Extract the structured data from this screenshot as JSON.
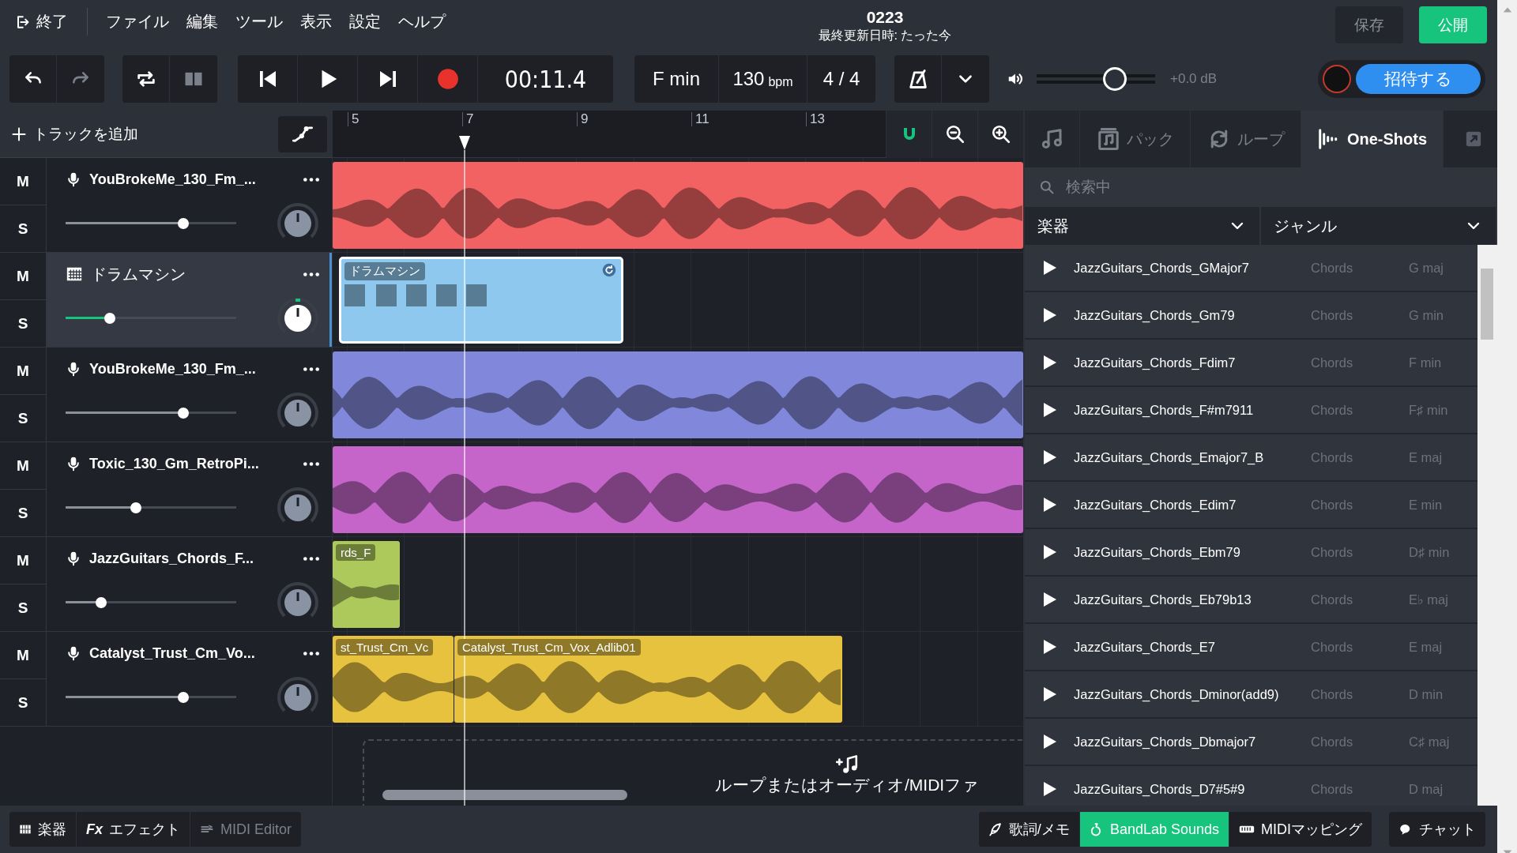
{
  "menu": {
    "exit": "終了",
    "items": [
      "ファイル",
      "編集",
      "ツール",
      "表示",
      "設定",
      "ヘルプ"
    ]
  },
  "project": {
    "title": "0223",
    "subtitle": "最終更新日時: たった今"
  },
  "actions": {
    "save": "保存",
    "publish": "公開",
    "invite": "招待する"
  },
  "toolbar": {
    "undo": {
      "disabled": false
    },
    "redo": {
      "disabled": true
    },
    "loop": {
      "disabled": false
    },
    "split": {
      "disabled": true
    },
    "time": "00:11.4",
    "key": "F min",
    "tempo": "130",
    "tempo_unit": "bpm",
    "signature": "4 / 4"
  },
  "master": {
    "level": 0.66,
    "reading": "+0.0 dB"
  },
  "add_track": "トラックを追加",
  "tracks": [
    {
      "kind": "audio",
      "name": "YouBrokeMe_130_Fm_...",
      "mute": "M",
      "solo": "S",
      "selected": false,
      "level": 0.69,
      "color": "#f26262"
    },
    {
      "kind": "drum",
      "name": "ドラムマシン",
      "mute": "M",
      "solo": "S",
      "selected": true,
      "level": 0.26,
      "color": "#8ec8ee",
      "clips": [
        {
          "label": "ドラムマシン"
        }
      ]
    },
    {
      "kind": "audio",
      "name": "YouBrokeMe_130_Fm_...",
      "mute": "M",
      "solo": "S",
      "selected": false,
      "level": 0.69,
      "color": "#8187da"
    },
    {
      "kind": "audio",
      "name": "Toxic_130_Gm_RetroPi...",
      "mute": "M",
      "solo": "S",
      "selected": false,
      "level": 0.41,
      "color": "#c565c9"
    },
    {
      "kind": "audio",
      "name": "JazzGuitars_Chords_F...",
      "mute": "M",
      "solo": "S",
      "selected": false,
      "level": 0.21,
      "color": "#adc95c",
      "clips": [
        {
          "label": "rds_F"
        }
      ]
    },
    {
      "kind": "audio",
      "name": "Catalyst_Trust_Cm_Vo...",
      "mute": "M",
      "solo": "S",
      "selected": false,
      "level": 0.69,
      "color": "#e7c23f",
      "clips": [
        {
          "label": "st_Trust_Cm_Vc"
        },
        {
          "label": "Catalyst_Trust_Cm_Vox_Adlib01"
        }
      ]
    }
  ],
  "ruler": [
    "5",
    "7",
    "9",
    "11",
    "13"
  ],
  "drop_hint": "ループまたはオーディオ/MIDIファ",
  "browser": {
    "tabs": [
      {
        "kind": "instruments",
        "selected": false
      },
      {
        "kind": "packs",
        "label": "パック",
        "selected": false
      },
      {
        "kind": "loops",
        "label": "ループ",
        "selected": false
      },
      {
        "kind": "oneshots",
        "label": "One-Shots",
        "selected": true
      }
    ],
    "search": {
      "placeholder": "検索中"
    },
    "filters": [
      "楽器",
      "ジャンル"
    ],
    "rows": [
      {
        "name": "JazzGuitars_Chords_GMajor7",
        "category": "Chords",
        "key": "G maj"
      },
      {
        "name": "JazzGuitars_Chords_Gm79",
        "category": "Chords",
        "key": "G min"
      },
      {
        "name": "JazzGuitars_Chords_Fdim7",
        "category": "Chords",
        "key": "F min"
      },
      {
        "name": "JazzGuitars_Chords_F#m7911",
        "category": "Chords",
        "key": "F♯ min"
      },
      {
        "name": "JazzGuitars_Chords_Emajor7_B",
        "category": "Chords",
        "key": "E maj"
      },
      {
        "name": "JazzGuitars_Chords_Edim7",
        "category": "Chords",
        "key": "E min"
      },
      {
        "name": "JazzGuitars_Chords_Ebm79",
        "category": "Chords",
        "key": "D♯ min"
      },
      {
        "name": "JazzGuitars_Chords_Eb79b13",
        "category": "Chords",
        "key": "E♭ maj"
      },
      {
        "name": "JazzGuitars_Chords_E7",
        "category": "Chords",
        "key": "E maj"
      },
      {
        "name": "JazzGuitars_Chords_Dminor(add9)",
        "category": "Chords",
        "key": "D min"
      },
      {
        "name": "JazzGuitars_Chords_Dbmajor7",
        "category": "Chords",
        "key": "C♯ maj"
      },
      {
        "name": "JazzGuitars_Chords_D7#5#9",
        "category": "Chords",
        "key": "D maj"
      }
    ]
  },
  "bottom_left": [
    {
      "kind": "instruments",
      "label": "楽器",
      "disabled": false
    },
    {
      "kind": "effects",
      "icon_text": "Fx",
      "label": "エフェクト",
      "disabled": false
    },
    {
      "kind": "midi",
      "label": "MIDI Editor",
      "disabled": true
    }
  ],
  "bottom_right": [
    {
      "kind": "lyrics",
      "label": "歌詞/メモ",
      "selected": false
    },
    {
      "kind": "sounds",
      "label": "BandLab Sounds",
      "selected": true
    },
    {
      "kind": "mapping",
      "label": "MIDIマッピング",
      "selected": false
    },
    {
      "kind": "chat",
      "label": "チャット",
      "selected": false
    }
  ]
}
